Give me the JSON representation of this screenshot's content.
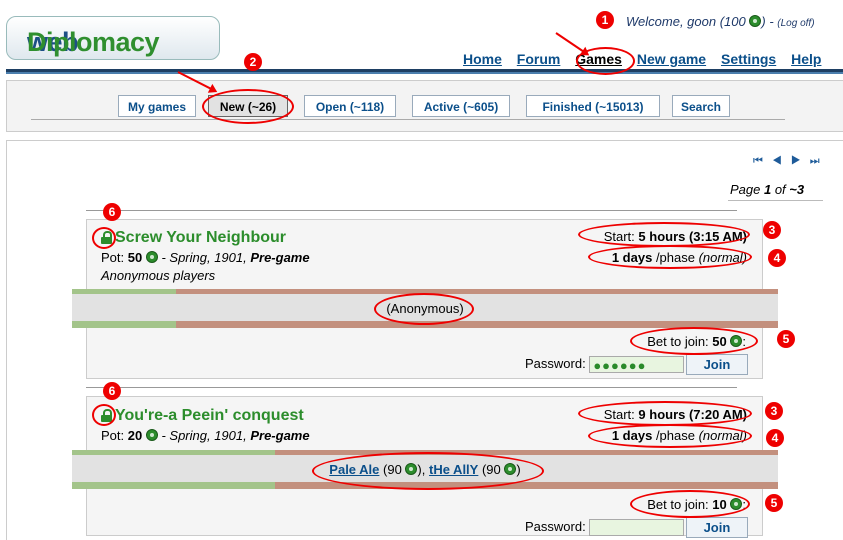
{
  "header": {
    "logo_web": "web",
    "logo_dip": "Diplomacy",
    "welcome_prefix": "Welcome, ",
    "username": "goon",
    "points": "(100",
    "points_suffix": ")",
    "logoff_prefix": " - ",
    "logoff": "(Log off)"
  },
  "nav": {
    "items": [
      "Home",
      "Forum",
      "Games",
      "New game",
      "Settings",
      "Help"
    ]
  },
  "subtabs": [
    "My games",
    "New (~26)",
    "Open (~118)",
    "Active (~605)",
    "Finished (~15013)",
    "Search"
  ],
  "pager": {
    "icons": "⏮ ◀ ▶ ⏭",
    "page_label": "Page ",
    "page_current": "1",
    "page_of": " of ",
    "page_total": "~3"
  },
  "games": [
    {
      "name": "Screw Your Neighbour",
      "pot_label": "Pot: ",
      "pot_value": "50",
      "season": " - Spring, 1901, ",
      "phase_state": "Pre-game",
      "anon_note": "Anonymous players",
      "start_label": "Start: ",
      "start_value": "5 hours (3:15 AM)",
      "days_value": "1 days",
      "phase_label": " /phase ",
      "phase_type": "(normal)",
      "members_text": "(Anonymous)",
      "bet_label": "Bet to join: ",
      "bet_value": "50",
      "bet_suffix": ":",
      "password_label": "Password: ",
      "password_value": "●●●●●●",
      "join_label": "Join"
    },
    {
      "name": "You're-a Peein' conquest",
      "pot_label": "Pot: ",
      "pot_value": "20",
      "season": " - Spring, 1901, ",
      "phase_state": "Pre-game",
      "start_label": "Start: ",
      "start_value": "9 hours (7:20 AM)",
      "days_value": "1 days",
      "phase_label": " /phase ",
      "phase_type": "(normal)",
      "member1": "Pale Ale",
      "member1_pts": " (90 ",
      "member1_end": "), ",
      "member2": "tHe AllY",
      "member2_pts": " (90 ",
      "member2_end": ")",
      "bet_label": "Bet to join: ",
      "bet_value": "10",
      "bet_suffix": ":",
      "password_label": "Password: ",
      "join_label": "Join"
    }
  ],
  "annotations": {
    "n1": "1",
    "n2": "2",
    "n3": "3",
    "n4": "4",
    "n5": "5",
    "n6": "6",
    "color": "#e00000"
  },
  "colors": {
    "link": "#0b4f8a",
    "game_name": "#2c8d2c",
    "nav_bar": "#1e3f63"
  }
}
